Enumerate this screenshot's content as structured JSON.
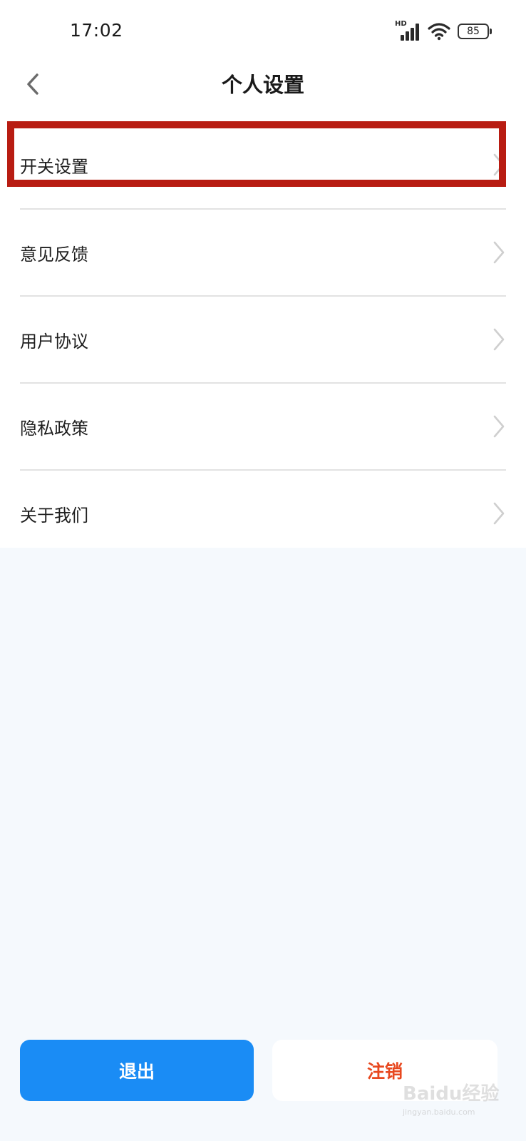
{
  "status_bar": {
    "time": "17:02",
    "network": "HD",
    "battery": "85",
    "icons": [
      "signal-icon",
      "wifi-icon",
      "battery-icon"
    ]
  },
  "nav": {
    "back_icon": "chevron-left-icon",
    "title": "个人设置"
  },
  "menu": {
    "items": [
      {
        "label": "开关设置"
      },
      {
        "label": "意见反馈"
      },
      {
        "label": "用户协议"
      },
      {
        "label": "隐私政策"
      },
      {
        "label": "关于我们"
      }
    ]
  },
  "buttons": {
    "logout": "退出",
    "cancel_account": "注销"
  },
  "watermark": {
    "logo": "Baidu经验",
    "url": "jingyan.baidu.com"
  },
  "colors": {
    "primary": "#1a8cf5",
    "danger": "#e8481f",
    "highlight": "#b81c12",
    "page_bg": "#f5f9fd"
  }
}
